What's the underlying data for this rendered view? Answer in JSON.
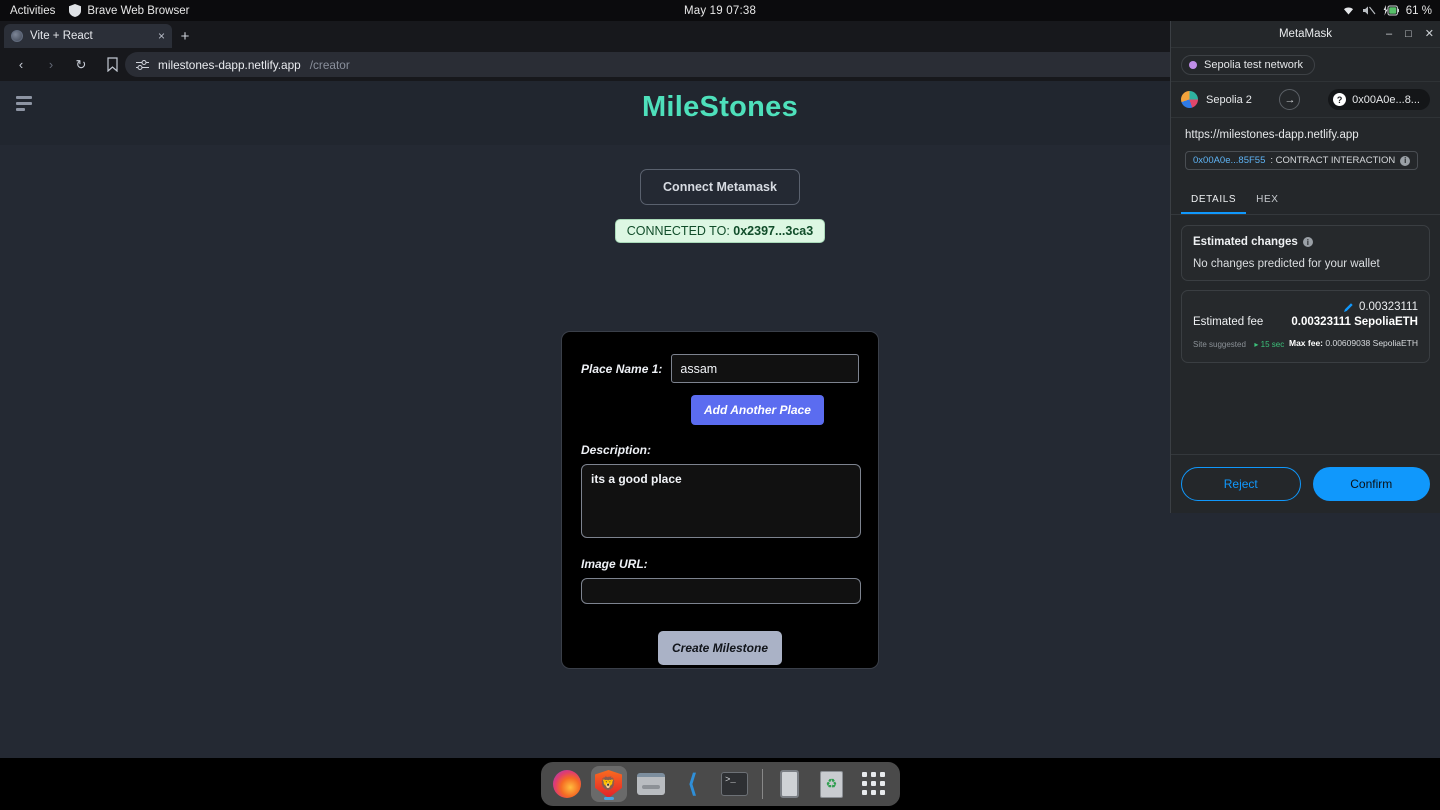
{
  "os_topbar": {
    "activities": "Activities",
    "app_name": "Brave Web Browser",
    "clock": "May 19  07:38",
    "battery": "61 %",
    "icons": [
      "wifi-icon",
      "volume-muted-icon",
      "battery-charging-icon"
    ]
  },
  "browser": {
    "tab": {
      "title": "Vite + React",
      "close": "×"
    },
    "new_tab": "+",
    "nav": {
      "back": "‹",
      "forward": "›",
      "reload": "↻"
    },
    "url": {
      "host": "milestones-dapp.netlify.app",
      "path": "/creator"
    },
    "toolbar_icons": [
      "share-icon",
      "brave-shields-icon",
      "brave-rewards-icon"
    ]
  },
  "page": {
    "title": "MileStones",
    "connect_button": "Connect Metamask",
    "connected_prefix": "CONNECTED TO: ",
    "connected_address": "0x2397...3ca3",
    "form": {
      "place_label": "Place Name 1:",
      "place_value": "assam",
      "place_placeholder": "",
      "add_place_button": "Add Another Place",
      "description_label": "Description:",
      "description_value": "its a good place",
      "description_placeholder": "",
      "image_label": "Image URL:",
      "image_value": "",
      "image_placeholder": "",
      "submit_button": "Create Milestone"
    }
  },
  "metamask": {
    "window_title": "MetaMask",
    "window_buttons": {
      "minimize": "–",
      "maximize": "□",
      "close": "✕"
    },
    "network": "Sepolia test network",
    "account_name": "Sepolia 2",
    "recipient": "0x00A0e...8...",
    "origin": "https://milestones-dapp.netlify.app",
    "contract_address": "0x00A0e...85F55",
    "contract_label": ": CONTRACT INTERACTION",
    "tabs": [
      {
        "label": "DETAILS",
        "active": true
      },
      {
        "label": "HEX",
        "active": false
      }
    ],
    "estimated_changes": {
      "title": "Estimated changes",
      "body": "No changes predicted for your wallet"
    },
    "fee": {
      "edit_amount": "0.00323111",
      "label": "Estimated fee",
      "amount": "0.00323111 SepoliaETH",
      "site_suggested": "Site suggested",
      "eta": "▸ 15 sec",
      "max_fee_label": "Max fee:",
      "max_fee_value": "0.00609038 SepoliaETH"
    },
    "reject_button": "Reject",
    "confirm_button": "Confirm"
  },
  "dock": {
    "items": [
      {
        "name": "firefox",
        "active": false
      },
      {
        "name": "brave",
        "active": true
      },
      {
        "name": "files",
        "active": false
      },
      {
        "name": "vscode",
        "active": false
      },
      {
        "name": "terminal",
        "active": false
      },
      {
        "name": "tablet",
        "active": false
      },
      {
        "name": "trash",
        "active": false
      },
      {
        "name": "show-apps",
        "active": false
      }
    ],
    "terminal_glyph": ">_"
  },
  "colors": {
    "accent_teal": "#4ee0bb",
    "metamask_blue": "#1098fc",
    "button_indigo": "#5b6cf0",
    "connected_green_bg": "#ddf7e3"
  }
}
